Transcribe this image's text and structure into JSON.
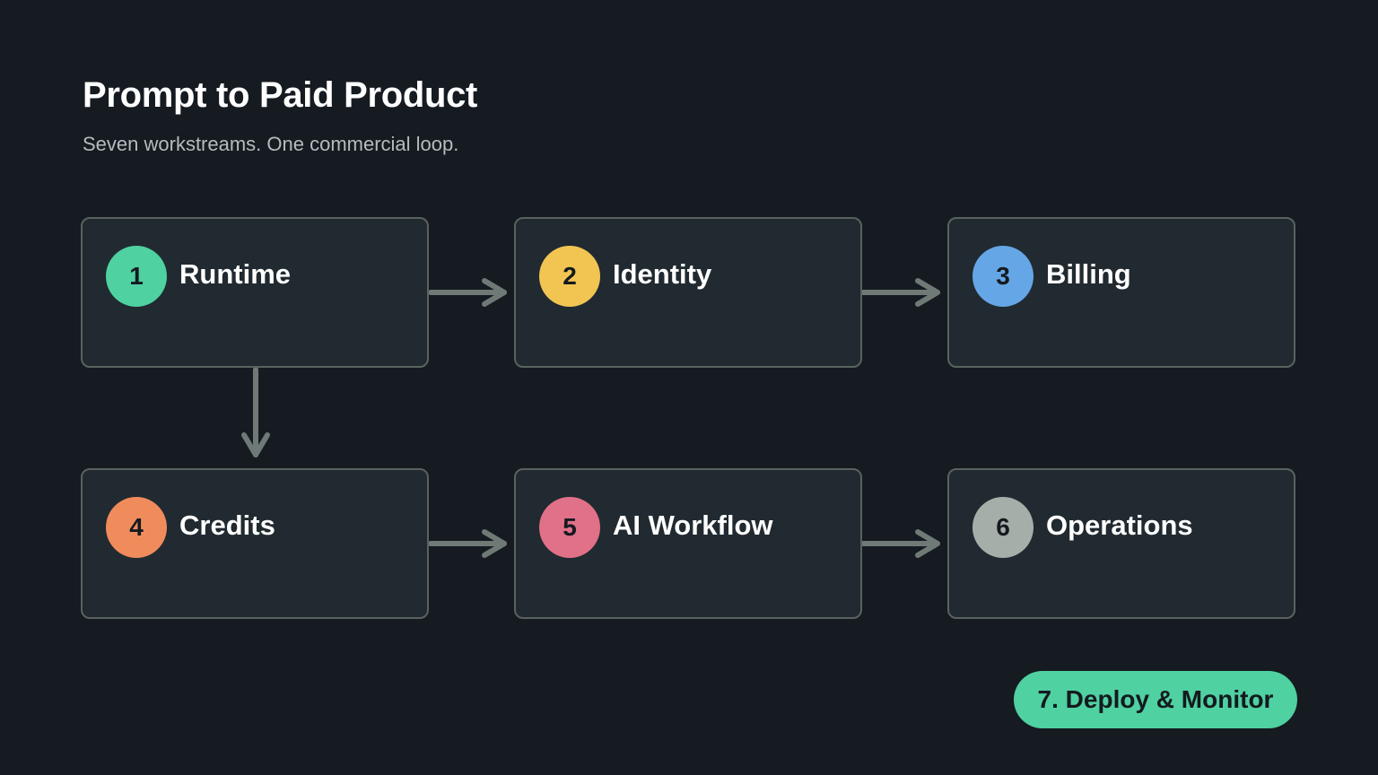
{
  "title": "Prompt to Paid Product",
  "subtitle": "Seven workstreams. One commercial loop.",
  "nodes": [
    {
      "number": "1",
      "label": "Runtime",
      "color": "#4fd1a1"
    },
    {
      "number": "2",
      "label": "Identity",
      "color": "#f2c553"
    },
    {
      "number": "3",
      "label": "Billing",
      "color": "#65a6e6"
    },
    {
      "number": "4",
      "label": "Credits",
      "color": "#f08c5c"
    },
    {
      "number": "5",
      "label": "AI Workflow",
      "color": "#e17089"
    },
    {
      "number": "6",
      "label": "Operations",
      "color": "#a6aeaa"
    }
  ],
  "edges": [
    {
      "from": "1",
      "to": "2"
    },
    {
      "from": "2",
      "to": "3"
    },
    {
      "from": "1",
      "to": "4"
    },
    {
      "from": "4",
      "to": "5"
    },
    {
      "from": "5",
      "to": "6"
    }
  ],
  "final_step": {
    "label": "7. Deploy & Monitor",
    "color": "#4fd1a1"
  },
  "colors": {
    "background": "#151b21",
    "card": "#212a30",
    "border": "#59625f",
    "arrow": "#6f7a76"
  }
}
